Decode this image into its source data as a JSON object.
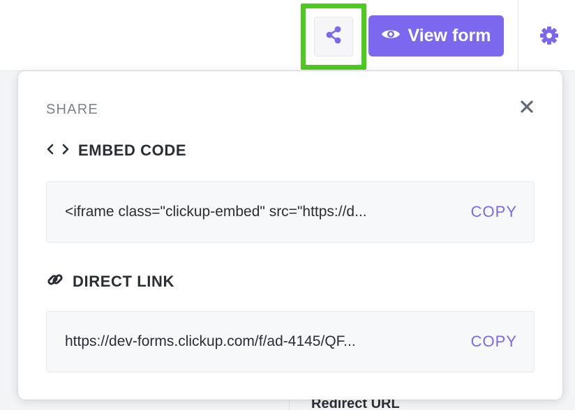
{
  "toolbar": {
    "share_icon": "share-icon",
    "view_form_label": "View form",
    "view_form_icon": "eye-icon",
    "settings_icon": "gear-icon",
    "accent_color": "#7b68ee",
    "highlight_color": "#4ccb21"
  },
  "background": {
    "peek_text": "Redirect URL"
  },
  "share_popover": {
    "title": "SHARE",
    "close_icon": "close-icon",
    "embed": {
      "icon": "code-icon",
      "label": "EMBED CODE",
      "value": "<iframe class=\"clickup-embed\" src=\"https://d...",
      "copy_label": "COPY"
    },
    "direct_link": {
      "icon": "link-icon",
      "label": "DIRECT LINK",
      "value": "https://dev-forms.clickup.com/f/ad-4145/QF...",
      "copy_label": "COPY"
    }
  }
}
